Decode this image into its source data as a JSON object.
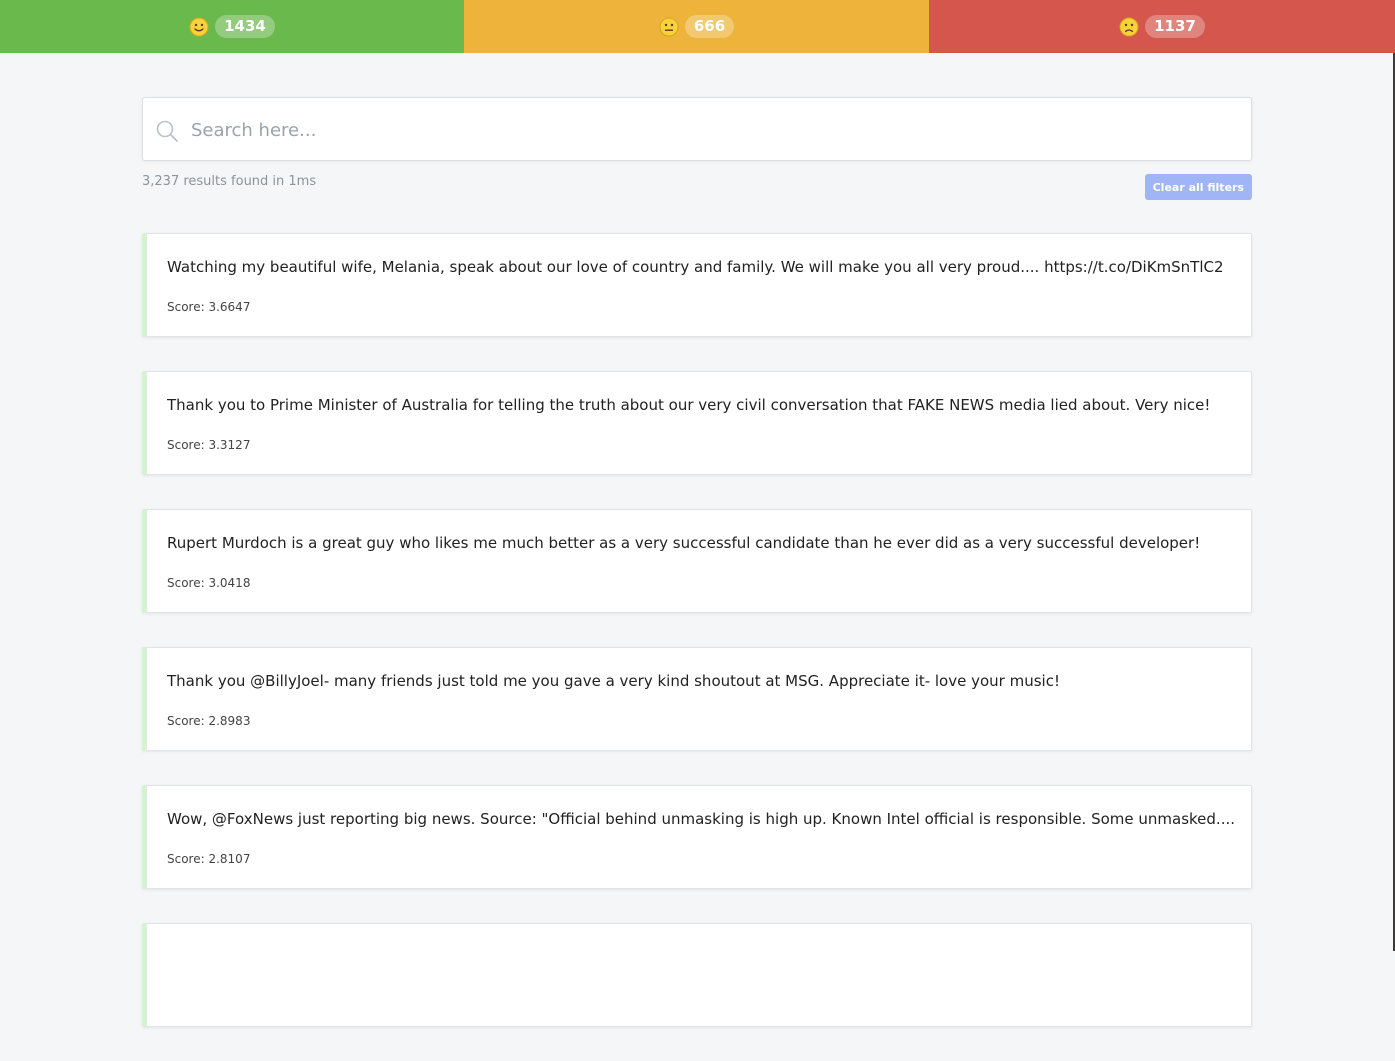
{
  "sentiment_bar": {
    "positive": {
      "count": "1434",
      "color": "#6ab94d",
      "icon": "smiling-face-icon"
    },
    "neutral": {
      "count": "666",
      "color": "#eeb33a",
      "icon": "neutral-face-icon"
    },
    "negative": {
      "count": "1137",
      "color": "#d5564c",
      "icon": "frowning-face-icon"
    }
  },
  "search": {
    "placeholder": "Search here...",
    "value": ""
  },
  "stats": {
    "result_text": "3,237 results found in 1ms",
    "clear_label": "Clear all filters"
  },
  "results": [
    {
      "text": "Watching my beautiful wife, Melania, speak about our love of country and family. We will make you all very proud.... https://t.co/DiKmSnTlC2",
      "score": "Score: 3.6647"
    },
    {
      "text": "Thank you to Prime Minister of Australia for telling the truth about our very civil conversation that FAKE NEWS media lied about. Very nice!",
      "score": "Score: 3.3127"
    },
    {
      "text": "Rupert Murdoch is a great guy who likes me much better as a very successful candidate than he ever did as a very successful developer!",
      "score": "Score: 3.0418"
    },
    {
      "text": "Thank you @BillyJoel- many friends just told me you gave a very kind shoutout at MSG. Appreciate it- love your music!",
      "score": "Score: 2.8983"
    },
    {
      "text": "Wow, @FoxNews just reporting big news. Source: \"Official behind unmasking is high up. Known Intel official is responsible. Some unmasked....",
      "score": "Score: 2.8107"
    },
    {
      "text": "",
      "score": ""
    }
  ],
  "colors": {
    "card_accent": "#d6f1d3",
    "clear_button": "#9fb5f5",
    "page_background": "#f5f6f7"
  }
}
